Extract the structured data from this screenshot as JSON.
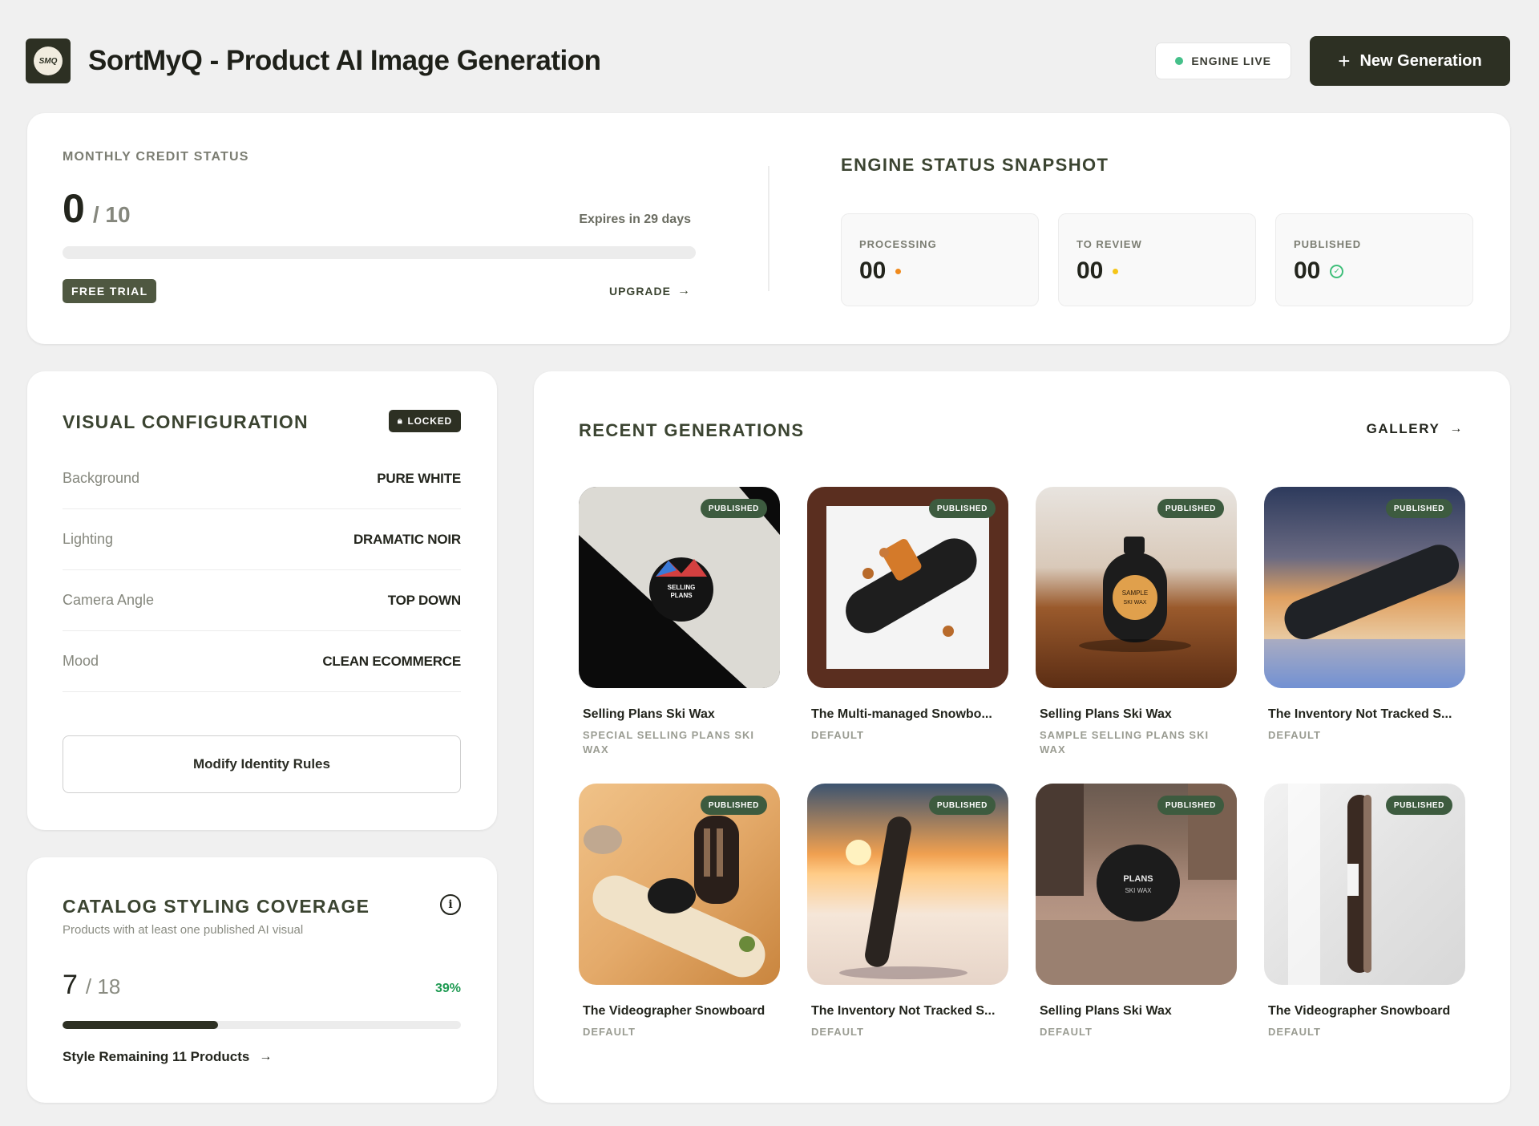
{
  "header": {
    "logo_text": "SMQ",
    "title": "SortMyQ - Product AI Image Generation",
    "engine_status": "ENGINE LIVE",
    "new_button": "New Generation"
  },
  "credits": {
    "label": "MONTHLY CREDIT STATUS",
    "used": "0",
    "total": "/ 10",
    "expires": "Expires in 29 days",
    "used_fraction": 0,
    "plan_badge": "FREE TRIAL",
    "upgrade_label": "UPGRADE"
  },
  "engine_snapshot": {
    "title": "ENGINE STATUS SNAPSHOT",
    "stats": [
      {
        "label": "PROCESSING",
        "value": "00",
        "indicator": "dot",
        "color": "#f08a1c"
      },
      {
        "label": "TO REVIEW",
        "value": "00",
        "indicator": "dot",
        "color": "#f5c518"
      },
      {
        "label": "PUBLISHED",
        "value": "00",
        "indicator": "check-icon",
        "color": "#3fbf7a"
      }
    ]
  },
  "visual_config": {
    "title": "VISUAL CONFIGURATION",
    "locked_badge": "LOCKED",
    "rows": [
      {
        "key": "Background",
        "value": "PURE WHITE"
      },
      {
        "key": "Lighting",
        "value": "DRAMATIC NOIR"
      },
      {
        "key": "Camera Angle",
        "value": "TOP DOWN"
      },
      {
        "key": "Mood",
        "value": "CLEAN ECOMMERCE"
      }
    ],
    "modify_button": "Modify Identity Rules"
  },
  "coverage": {
    "title": "CATALOG STYLING COVERAGE",
    "subtitle": "Products with at least one published AI visual",
    "count": "7",
    "total": "/ 18",
    "percent": "39%",
    "fraction": 0.39,
    "link": "Style Remaining 11 Products"
  },
  "recent": {
    "title": "RECENT GENERATIONS",
    "gallery_link": "GALLERY",
    "items": [
      {
        "name": "Selling Plans Ski Wax",
        "sub": "SPECIAL SELLING PLANS SKI WAX",
        "badge": "PUBLISHED"
      },
      {
        "name": "The Multi-managed Snowbo...",
        "sub": "DEFAULT",
        "badge": "PUBLISHED"
      },
      {
        "name": "Selling Plans Ski Wax",
        "sub": "SAMPLE SELLING PLANS SKI WAX",
        "badge": "PUBLISHED"
      },
      {
        "name": "The Inventory Not Tracked S...",
        "sub": "DEFAULT",
        "badge": "PUBLISHED"
      },
      {
        "name": "The Videographer Snowboard",
        "sub": "DEFAULT",
        "badge": "PUBLISHED"
      },
      {
        "name": "The Inventory Not Tracked S...",
        "sub": "DEFAULT",
        "badge": "PUBLISHED"
      },
      {
        "name": "Selling Plans Ski Wax",
        "sub": "DEFAULT",
        "badge": "PUBLISHED"
      },
      {
        "name": "The Videographer Snowboard",
        "sub": "DEFAULT",
        "badge": "PUBLISHED"
      }
    ]
  },
  "colors": {
    "brand_dark": "#2d3023",
    "accent_olive": "#3b4431",
    "badge_green": "#3d5b3f",
    "success": "#1e9a52",
    "live_dot": "#45c08a"
  }
}
